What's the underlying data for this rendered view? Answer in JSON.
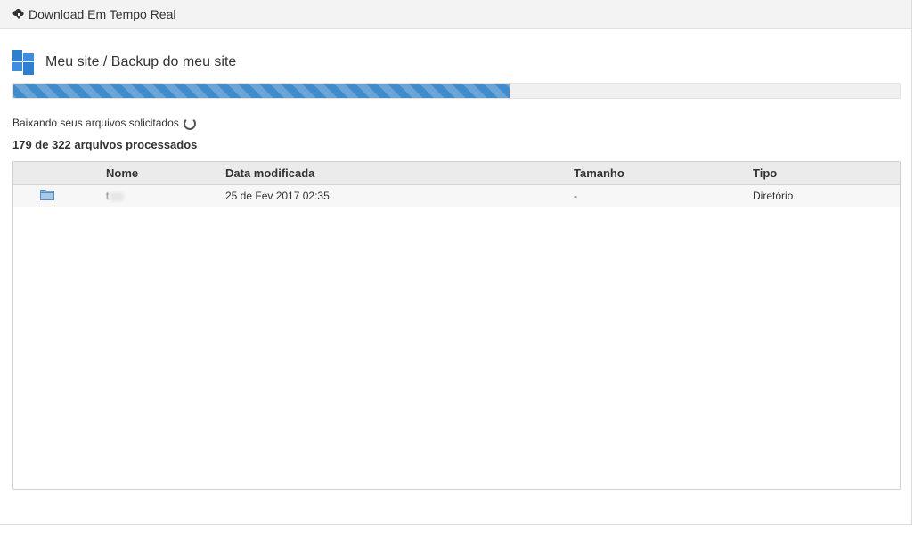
{
  "header": {
    "title": "Download Em Tempo Real",
    "icon": "cloud-download-icon"
  },
  "breadcrumb": {
    "text": "Meu site / Backup do meu site",
    "icon": "windows-logo-icon"
  },
  "progress": {
    "percent": 56,
    "color": "#428bca"
  },
  "status": {
    "text": "Baixando seus arquivos solicitados"
  },
  "counter": {
    "text": "179 de 322 arquivos processados"
  },
  "table": {
    "columns": [
      "",
      "Nome",
      "Data modificada",
      "Tamanho",
      "Tipo"
    ],
    "rows": [
      {
        "icon": "folder-icon",
        "name": "t",
        "date": "25 de Fev 2017 02:35",
        "size": "-",
        "type": "Diretório"
      }
    ]
  }
}
